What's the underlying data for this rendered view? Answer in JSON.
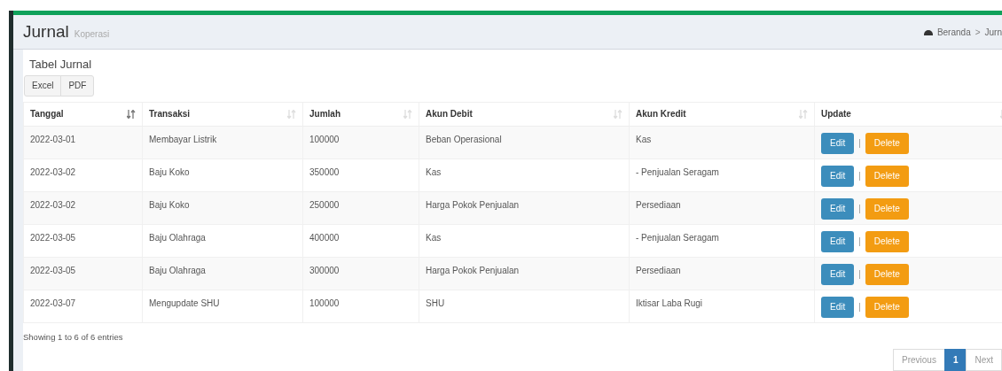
{
  "page_header": {
    "title": "Jurnal",
    "subtitle": "Koperasi"
  },
  "breadcrumb": {
    "items": [
      "Beranda",
      "Jurn"
    ],
    "separator": ">"
  },
  "box": {
    "title": "Tabel Jurnal",
    "export_buttons": [
      "Excel",
      "PDF"
    ]
  },
  "table": {
    "columns": [
      {
        "label": "Tanggal",
        "sorted": true
      },
      {
        "label": "Transaksi",
        "sorted": false
      },
      {
        "label": "Jumlah",
        "sorted": false
      },
      {
        "label": "Akun Debit",
        "sorted": false
      },
      {
        "label": "Akun Kredit",
        "sorted": false
      },
      {
        "label": "Update",
        "sorted": false
      }
    ],
    "rows": [
      {
        "cells": [
          "2022-03-01",
          "Membayar Listrik",
          "100000",
          "Beban Operasional",
          "Kas"
        ],
        "actions": [
          "Edit",
          "|",
          "Delete"
        ]
      },
      {
        "cells": [
          "2022-03-02",
          "Baju Koko",
          "350000",
          "Kas",
          "- Penjualan Seragam"
        ],
        "actions": [
          "Edit",
          "|",
          "Delete"
        ]
      },
      {
        "cells": [
          "2022-03-02",
          "Baju Koko",
          "250000",
          "Harga Pokok Penjualan",
          "Persediaan"
        ],
        "actions": [
          "Edit",
          "|",
          "Delete"
        ]
      },
      {
        "cells": [
          "2022-03-05",
          "Baju Olahraga",
          "400000",
          "Kas",
          "- Penjualan Seragam"
        ],
        "actions": [
          "Edit",
          "|",
          "Delete"
        ]
      },
      {
        "cells": [
          "2022-03-05",
          "Baju Olahraga",
          "300000",
          "Harga Pokok Penjualan",
          "Persediaan"
        ],
        "actions": [
          "Edit",
          "|",
          "Delete"
        ]
      },
      {
        "cells": [
          "2022-03-07",
          "Mengupdate SHU",
          "100000",
          "SHU",
          "Iktisar Laba Rugi"
        ],
        "actions": [
          "Edit",
          "|",
          "Delete"
        ]
      }
    ]
  },
  "info": "Showing 1 to 6 of 6 entries",
  "pagination": [
    {
      "label": "Previous",
      "selected": false
    },
    {
      "label": "1",
      "selected": true
    },
    {
      "label": "Next",
      "selected": false
    }
  ]
}
